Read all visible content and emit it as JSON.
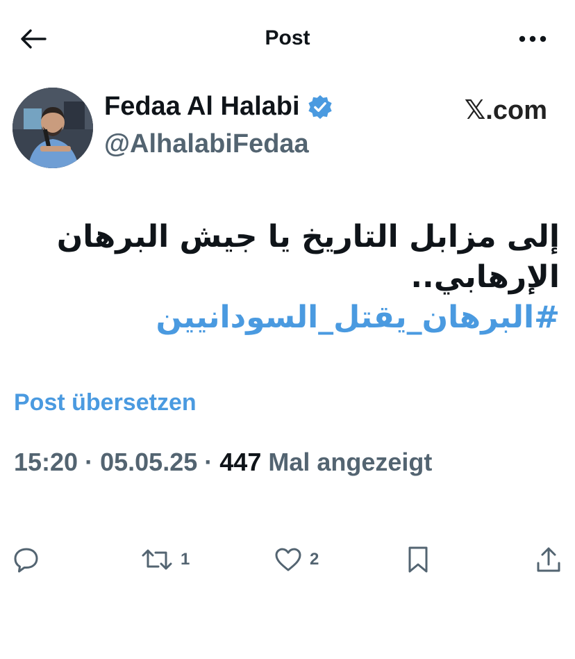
{
  "header": {
    "title": "Post"
  },
  "author": {
    "display_name": "Fedaa Al Halabi",
    "handle": "@AlhalabiFedaa",
    "verified": true
  },
  "watermark": "𝕏.com",
  "tweet": {
    "lines": [
      "إلى مزابل التاريخ يا جيش البرهان",
      "الإرهابي.."
    ],
    "hashtag": "#البرهان_يقتل_السودانيين"
  },
  "translate_label": "Post übersetzen",
  "meta": {
    "time": "15:20",
    "date": "05.05.25",
    "views_count": "447",
    "views_label": "Mal angezeigt",
    "separator": "·"
  },
  "actions": {
    "reposts": "1",
    "likes": "2"
  },
  "colors": {
    "accent": "#4a9ae0",
    "secondary_text": "#536471",
    "primary_text": "#0f1419"
  }
}
